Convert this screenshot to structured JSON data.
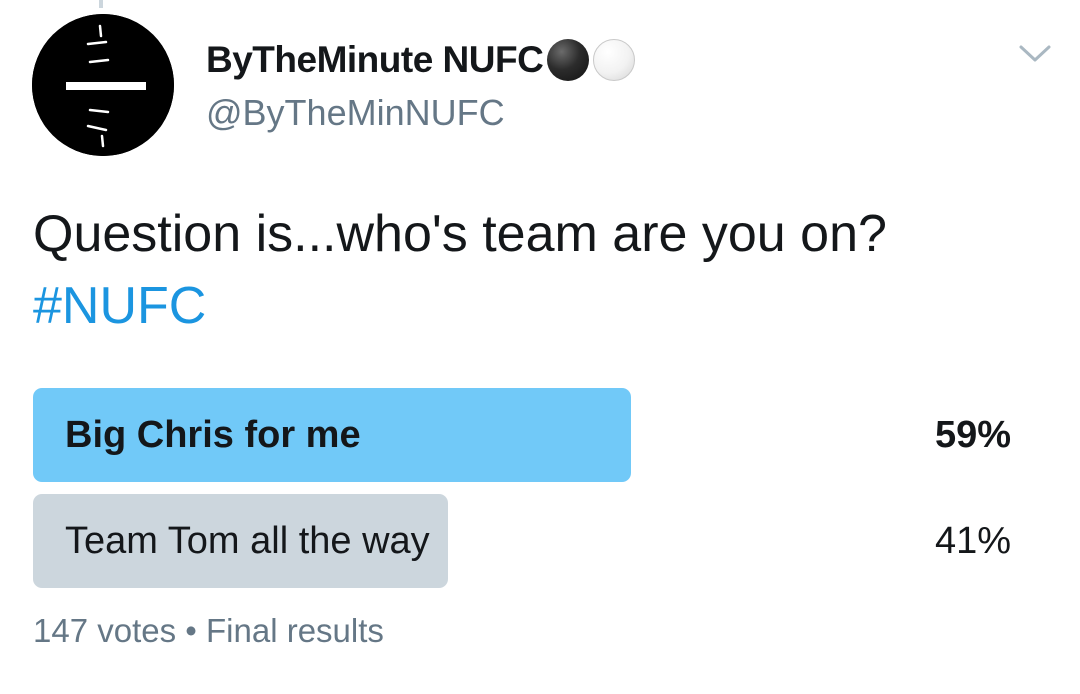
{
  "tweet": {
    "display_name": "ByTheMinute NUFC",
    "name_emoji": [
      "black-circle",
      "white-circle"
    ],
    "handle": "@ByTheMinNUFC",
    "text": "Question is...who's team are you on?",
    "hashtag": "#NUFC",
    "menu_icon": "chevron-down-icon",
    "avatar_icon": "stopwatch-logo"
  },
  "poll": {
    "options": [
      {
        "label": "Big Chris for me",
        "percent_label": "59%",
        "fraction": 0.59,
        "winner": true,
        "color": "#71c9f8"
      },
      {
        "label": "Team Tom all the way",
        "percent_label": "41%",
        "fraction": 0.41,
        "winner": false,
        "color": "#ccd6dd"
      }
    ],
    "votes": "147 votes",
    "separator": "•",
    "status": "Final results"
  },
  "colors": {
    "text": "#14171a",
    "secondary": "#657786",
    "link": "#1b95e0"
  }
}
